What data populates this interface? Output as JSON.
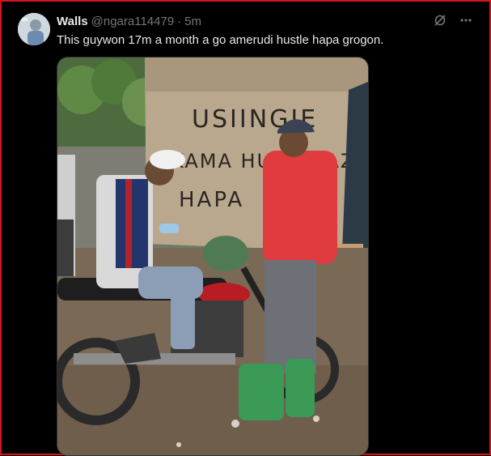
{
  "tweet": {
    "display_name": "Walls",
    "handle": "@ngara114479",
    "separator": "·",
    "time": "5m",
    "text": "This guywon 17m a month a go amerudi hustle hapa grogon.",
    "avatar_icon": "user-avatar",
    "grok_icon": "grok-icon",
    "more_icon": "more-horizontal-icon"
  },
  "media": {
    "sign_lines": [
      "USIINGIE",
      "KAMA HUNA KAZI",
      "HAPA"
    ],
    "accent_color": "#d4141c"
  }
}
